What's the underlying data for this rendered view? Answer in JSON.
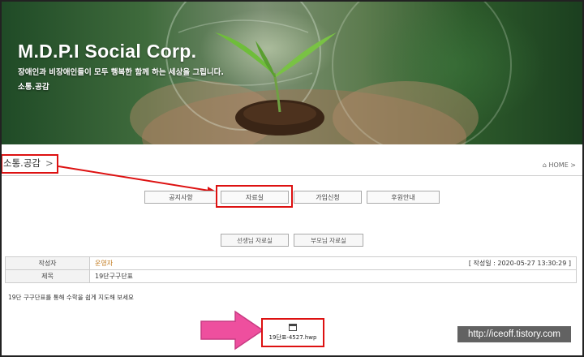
{
  "hero": {
    "title": "M.D.P.I Social Corp.",
    "subtitle": "장애인과 비장애인들이 모두 행복한 함께 하는 세상을 그립니다.",
    "section": "소통.공감"
  },
  "breadcrumb": {
    "section_title": "소통.공감",
    "chevron": ">",
    "home_link": "⌂ HOME >"
  },
  "tabs": [
    "공지사항",
    "자료실",
    "가입신청",
    "후원안내"
  ],
  "subtabs": [
    "선생님 자료실",
    "부모님 자료실"
  ],
  "post": {
    "author_label": "작성자",
    "author": "운영자",
    "date": "[ 작성일 : 2020-05-27 13:30:29 ]",
    "title_label": "제목",
    "title": "19단구구단표",
    "body": "19단 구구단표를 통해 수학을 쉽게 지도해 보세요"
  },
  "attachment": {
    "filename": "19단표-4527.hwp",
    "icon": "file-icon"
  },
  "watermark": "http://iceoff.tistory.com",
  "colors": {
    "annotation_red": "#d11111",
    "arrow_pink": "#ee4f9e",
    "author_orange": "#c27a1e"
  }
}
